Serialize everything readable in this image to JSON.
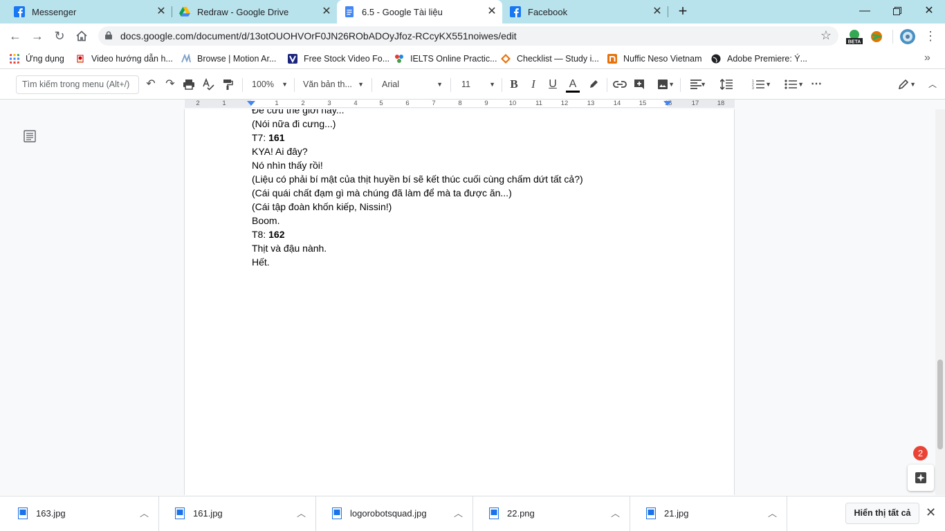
{
  "browser": {
    "tabs": [
      {
        "title": "Messenger",
        "icon": "facebook-icon",
        "active": false
      },
      {
        "title": "Redraw - Google Drive",
        "icon": "google-drive-icon",
        "active": false
      },
      {
        "title": "6.5 - Google Tài liệu",
        "icon": "google-docs-icon",
        "active": true
      },
      {
        "title": "Facebook",
        "icon": "facebook-icon",
        "active": false
      }
    ],
    "url": "docs.google.com/document/d/13otOUOHVOrF0JN26RObADOyJfoz-RCcyKX551noiwes/edit",
    "extension_badge": "BETA",
    "bookmarks": [
      {
        "label": "Ứng dụng",
        "icon": "apps-grid-icon"
      },
      {
        "label": "Video hướng dẫn h...",
        "icon": "video-icon"
      },
      {
        "label": "Browse | Motion Ar...",
        "icon": "motion-array-icon"
      },
      {
        "label": "Free Stock Video Fo...",
        "icon": "videvo-icon"
      },
      {
        "label": "IELTS Online Practic...",
        "icon": "ielts-icon"
      },
      {
        "label": "Checklist — Study i...",
        "icon": "checklist-icon"
      },
      {
        "label": "Nuffic Neso Vietnam",
        "icon": "nuffic-icon"
      },
      {
        "label": "Adobe Premiere: Ý...",
        "icon": "globe-icon"
      }
    ]
  },
  "toolbar": {
    "menu_search_placeholder": "Tìm kiếm trong menu (Alt+/)",
    "zoom": "100%",
    "style": "Văn bản th...",
    "font": "Arial",
    "font_size": "11",
    "text_color": "#000000"
  },
  "ruler": {
    "labels": [
      "2",
      "1",
      "1",
      "2",
      "3",
      "4",
      "5",
      "6",
      "7",
      "8",
      "9",
      "10",
      "11",
      "12",
      "13",
      "14",
      "15",
      "16",
      "17",
      "18"
    ]
  },
  "document": {
    "lines": [
      {
        "text": "Để cứu thế giới này...",
        "bold": ""
      },
      {
        "text": "(Nói nữa đi cưng...)",
        "bold": ""
      },
      {
        "text": "T7: ",
        "bold": "161"
      },
      {
        "text": "KYA! Ai đây?",
        "bold": ""
      },
      {
        "text": "Nó nhìn thấy rồi!",
        "bold": ""
      },
      {
        "text": "(Liệu có phải bí mật của thịt huyền bí sẽ kết thúc cuối cùng chấm dứt tất cả?)",
        "bold": ""
      },
      {
        "text": "(Cái quái chất đạm gì mà chúng đã làm để mà ta được ăn...)",
        "bold": ""
      },
      {
        "text": "(Cái tập đoàn khốn kiếp, Nissin!)",
        "bold": ""
      },
      {
        "text": "Boom.",
        "bold": ""
      },
      {
        "text": "T8: ",
        "bold": "162"
      },
      {
        "text": "Thịt và đậu nành.",
        "bold": ""
      },
      {
        "text": "Hết.",
        "bold": ""
      }
    ],
    "notification_count": "2"
  },
  "downloads": {
    "files": [
      {
        "name": "163.jpg"
      },
      {
        "name": "161.jpg"
      },
      {
        "name": "logorobotsquad.jpg"
      },
      {
        "name": "22.png"
      },
      {
        "name": "21.jpg"
      }
    ],
    "show_all_label": "Hiển thị tất cả"
  }
}
